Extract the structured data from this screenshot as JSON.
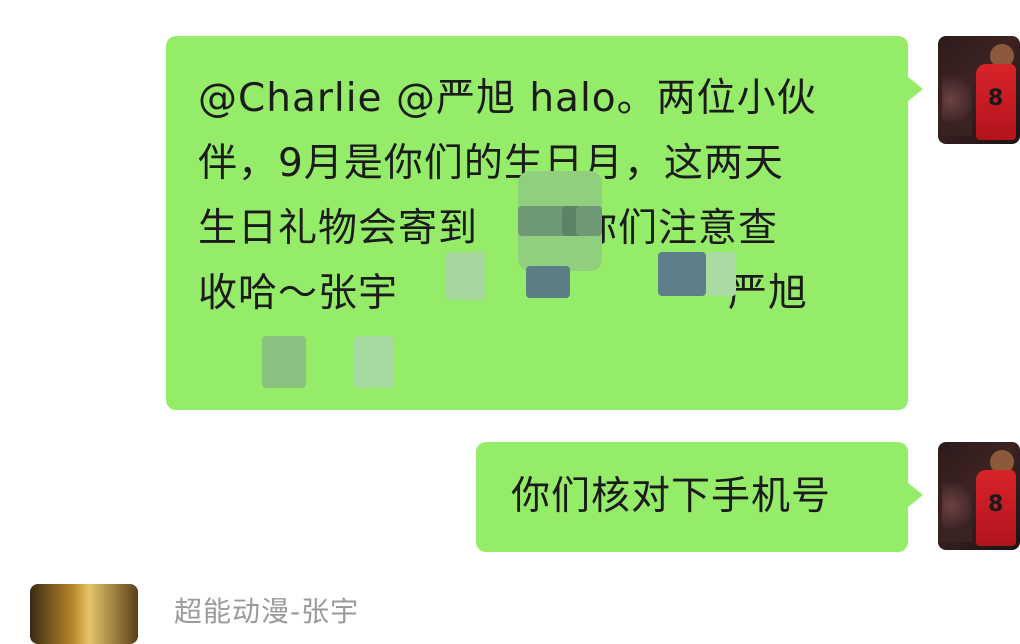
{
  "chat": {
    "messages": [
      {
        "lines": [
          "@Charlie @严旭  halo。两位小伙",
          "伴，9月是你们的生日月，这两天",
          "生日礼物会寄到",
          "你们注意查",
          "收哈～张宇",
          "严旭"
        ]
      },
      {
        "text": "你们核对下手机号"
      }
    ],
    "next_sender": "超能动漫-张宇"
  },
  "colors": {
    "bubble": "#95ec69",
    "sender_name": "#9a9a9a",
    "text": "#1b1b1b"
  },
  "icons": {
    "self_avatar": "avatar-basketball-player",
    "other_avatar": "avatar-anime"
  }
}
